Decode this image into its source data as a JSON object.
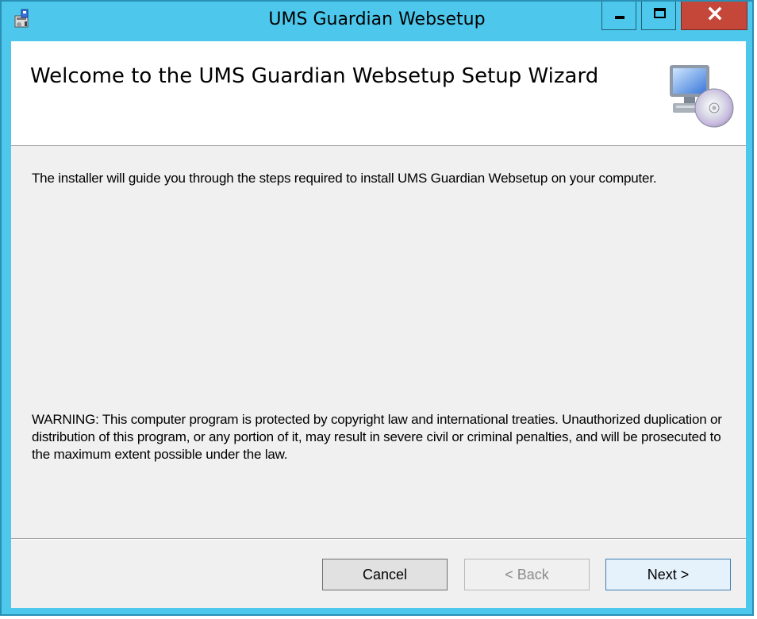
{
  "window": {
    "title": "UMS Guardian Websetup",
    "icons": {
      "app": "installer-icon",
      "minimize": "minimize-icon",
      "maximize": "maximize-icon",
      "close": "close-icon",
      "header": "computer-disc-icon"
    },
    "colors": {
      "frame": "#4dc8ec",
      "close_button": "#c4473a",
      "client": "#f0f0f0",
      "header": "#ffffff"
    }
  },
  "wizard": {
    "heading": "Welcome to the UMS Guardian Websetup Setup Wizard",
    "intro": "The installer will guide you through the steps required to install UMS Guardian Websetup on your computer.",
    "warning": "WARNING: This computer program is protected by copyright law and international treaties. Unauthorized duplication or distribution of this program, or any portion of it, may result in severe civil or criminal penalties, and will be prosecuted to the maximum extent possible under the law."
  },
  "buttons": {
    "cancel": "Cancel",
    "back": "< Back",
    "next": "Next >"
  }
}
